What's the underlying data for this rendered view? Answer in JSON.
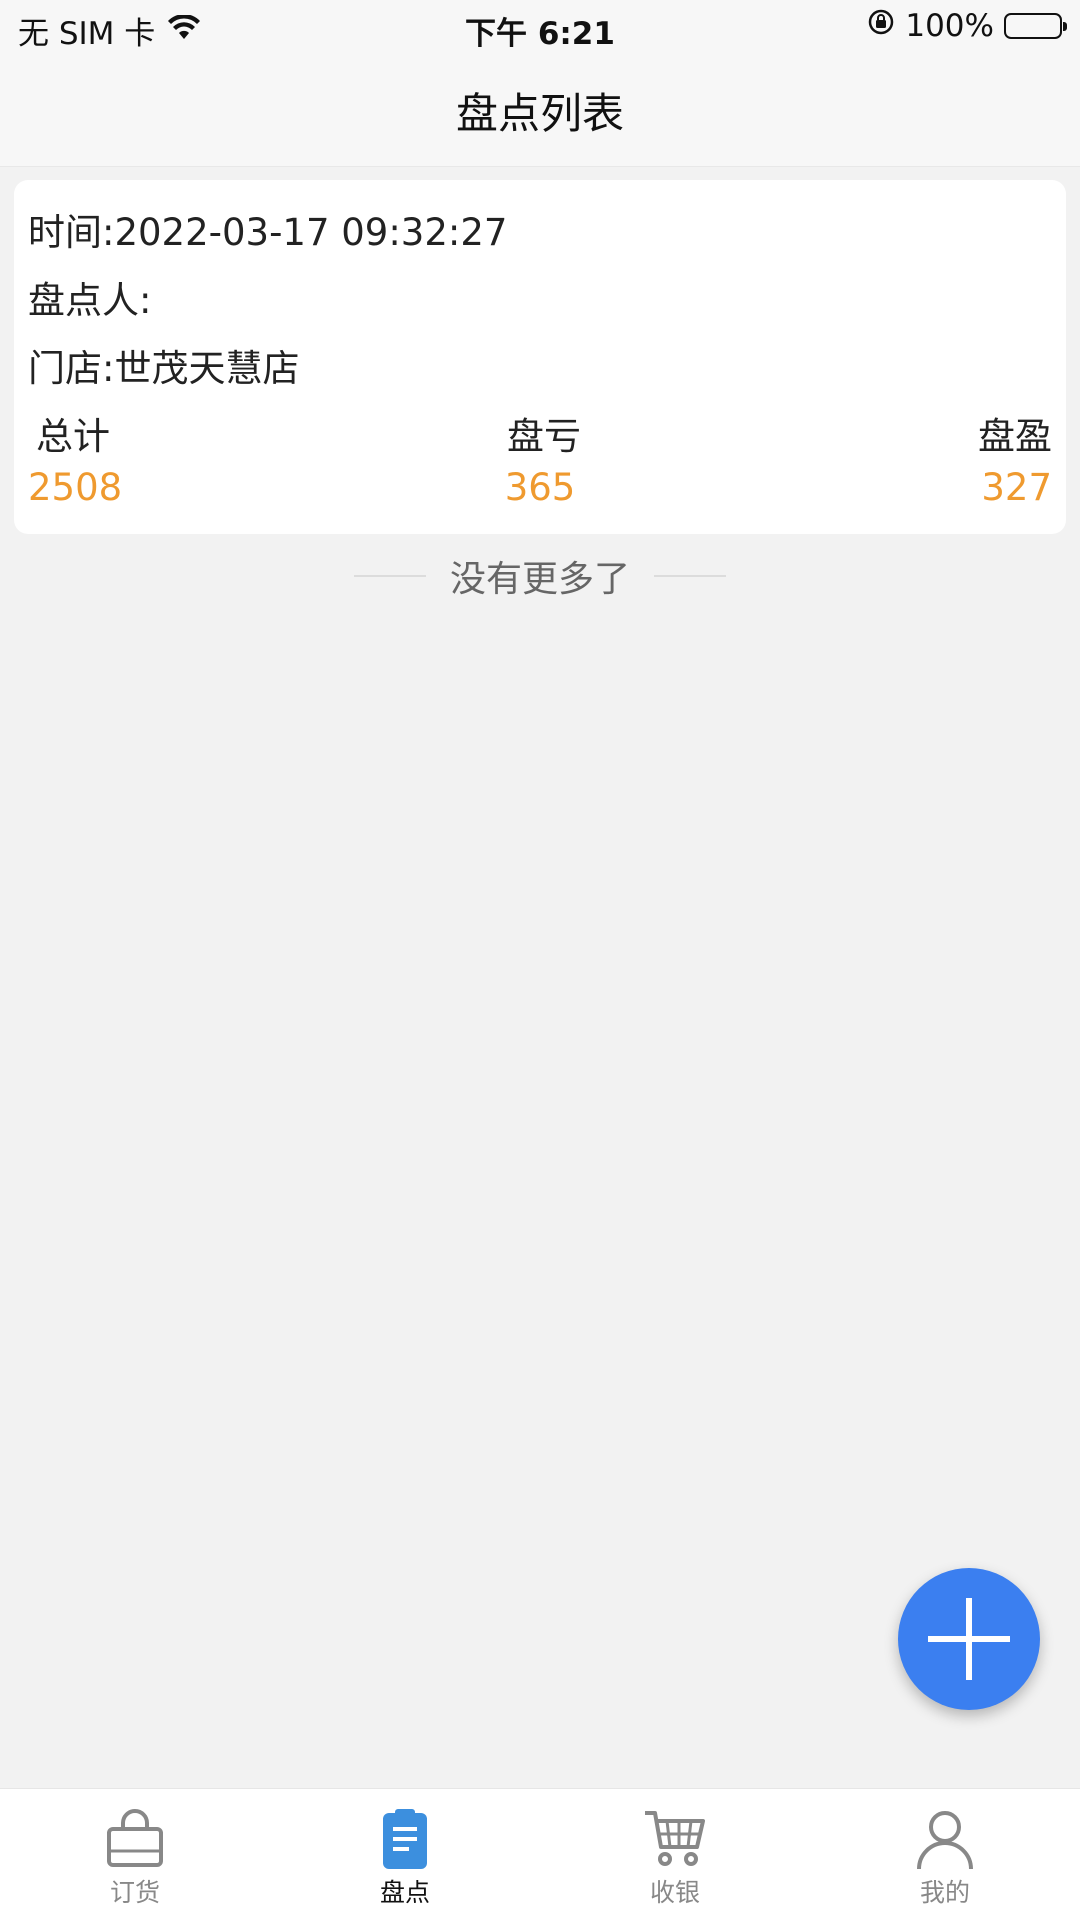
{
  "status_bar": {
    "carrier": "无 SIM 卡",
    "time": "下午 6:21",
    "battery": "100%"
  },
  "header": {
    "title": "盘点列表"
  },
  "record": {
    "time_label": "时间:",
    "time_value": "2022-03-17 09:32:27",
    "counter_label": "盘点人:",
    "counter_value": "",
    "store_label": "门店:",
    "store_value": "世茂天慧店",
    "stats": {
      "total_label": "总计",
      "total_value": "2508",
      "loss_label": "盘亏",
      "loss_value": "365",
      "gain_label": "盘盈",
      "gain_value": "327"
    }
  },
  "list_end": "没有更多了",
  "fab": {
    "icon": "plus-icon"
  },
  "tabbar": {
    "items": [
      {
        "label": "订货",
        "icon": "shopping-bag-icon",
        "active": false
      },
      {
        "label": "盘点",
        "icon": "clipboard-icon",
        "active": true
      },
      {
        "label": "收银",
        "icon": "shopping-cart-icon",
        "active": false
      },
      {
        "label": "我的",
        "icon": "user-icon",
        "active": false
      }
    ]
  },
  "colors": {
    "accent": "#3b7ff0",
    "stat_value": "#ef9a2f",
    "active_icon": "#3c8fde",
    "inactive_icon": "#888888"
  }
}
